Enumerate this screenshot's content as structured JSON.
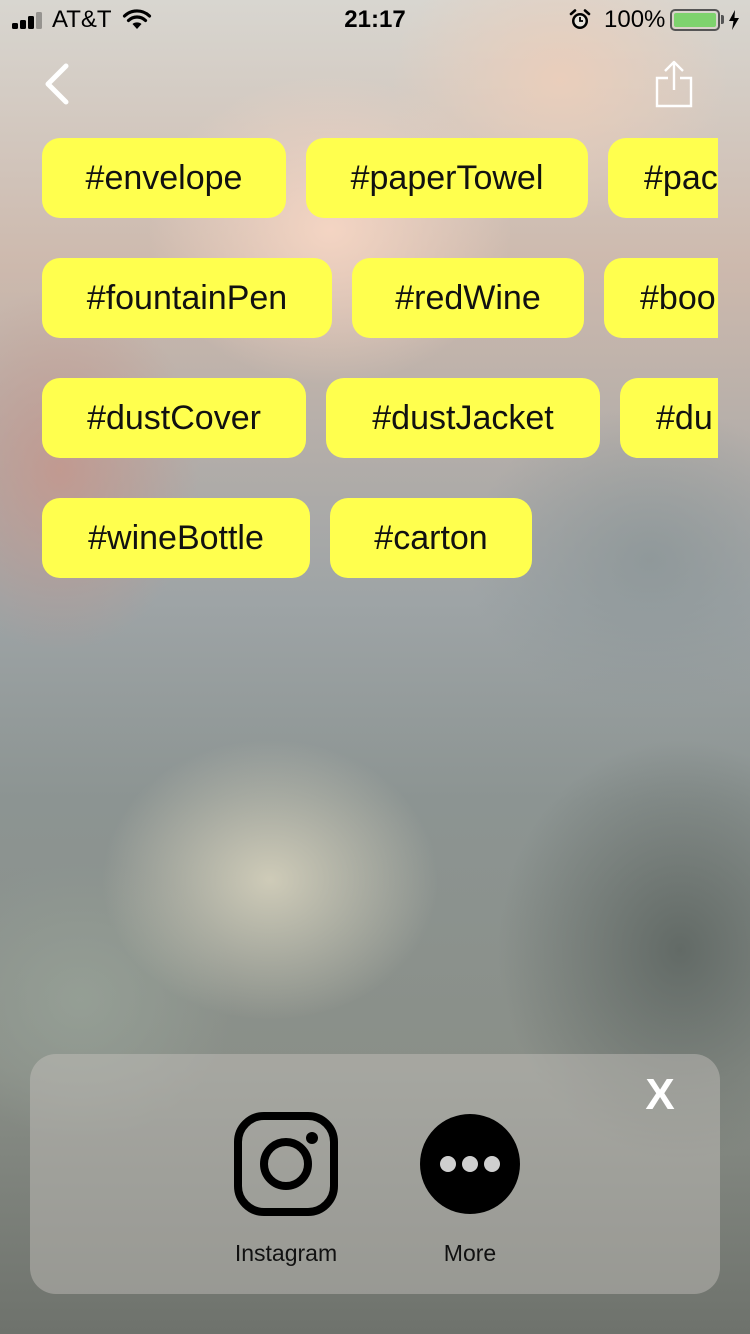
{
  "status_bar": {
    "carrier": "AT&T",
    "time": "21:17",
    "battery_percent": "100%",
    "battery_level": 1.0,
    "battery_color": "#7ed36e",
    "signal_bars_active": 3
  },
  "nav": {
    "back_icon": "chevron-left-icon",
    "share_icon": "share-icon"
  },
  "tags": [
    [
      "#envelope",
      "#paperTowel",
      "#pac"
    ],
    [
      "#fountainPen",
      "#redWine",
      "#boo"
    ],
    [
      "#dustCover",
      "#dustJacket",
      "#du"
    ],
    [
      "#wineBottle",
      "#carton"
    ]
  ],
  "tag_color": "#ffff4e",
  "share_panel": {
    "close_label": "X",
    "options": [
      {
        "label": "Instagram",
        "icon": "instagram-icon"
      },
      {
        "label": "More",
        "icon": "more-icon"
      }
    ]
  }
}
